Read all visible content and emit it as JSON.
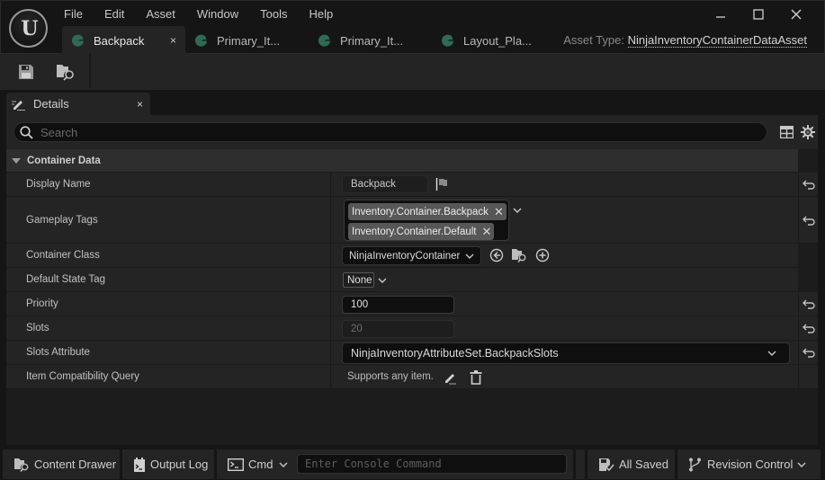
{
  "app": {
    "logo": "unreal-engine-logo",
    "menu": [
      "File",
      "Edit",
      "Asset",
      "Window",
      "Tools",
      "Help"
    ],
    "window_controls": {
      "minimize": "minimize-icon",
      "maximize": "maximize-icon",
      "close": "close-icon"
    },
    "tabs": [
      {
        "label": "Backpack",
        "active": true,
        "closable": true,
        "close_glyph": "×"
      },
      {
        "label": "Primary_It...",
        "active": false
      },
      {
        "label": "Primary_It...",
        "active": false
      },
      {
        "label": "Layout_Pla...",
        "active": false
      }
    ],
    "asset_type_label": "Asset Type:",
    "asset_type_value": "NinjaInventoryContainerDataAsset",
    "tab_icon_color": "#2e6b55"
  },
  "toolbar": {
    "buttons": [
      {
        "name": "save",
        "icon": "save-icon"
      },
      {
        "name": "browse",
        "icon": "browse-folder-icon"
      }
    ]
  },
  "details": {
    "tab_label": "Details",
    "tab_close": "×",
    "search_placeholder": "Search",
    "category": "Container Data",
    "properties": [
      {
        "name": "Display Name",
        "value": "Backpack",
        "has_reset": true
      },
      {
        "name": "Gameplay Tags",
        "tags": [
          "Inventory.Container.Backpack",
          "Inventory.Container.Default"
        ],
        "has_reset": true
      },
      {
        "name": "Container Class",
        "value": "NinjaInventoryContainer",
        "has_reset": false
      },
      {
        "name": "Default State Tag",
        "value": "None",
        "has_reset": false
      },
      {
        "name": "Priority",
        "value": "100",
        "has_reset": true
      },
      {
        "name": "Slots",
        "value": "20",
        "disabled": true,
        "has_reset": true
      },
      {
        "name": "Slots Attribute",
        "value": "NinjaInventoryAttributeSet.BackpackSlots",
        "has_reset": true
      },
      {
        "name": "Item Compatibility Query",
        "value": "Supports any item.",
        "has_reset": false
      }
    ],
    "tag_remove_glyph": "✕"
  },
  "statusbar": {
    "content_drawer": "Content Drawer",
    "output_log": "Output Log",
    "cmd": "Cmd",
    "console_placeholder": "Enter Console Command",
    "all_saved": "All Saved",
    "revision_control": "Revision Control"
  },
  "colors": {
    "background": "#151515",
    "panel": "#242424",
    "field": "#0f0f0f",
    "tag_chip": "#575757"
  }
}
